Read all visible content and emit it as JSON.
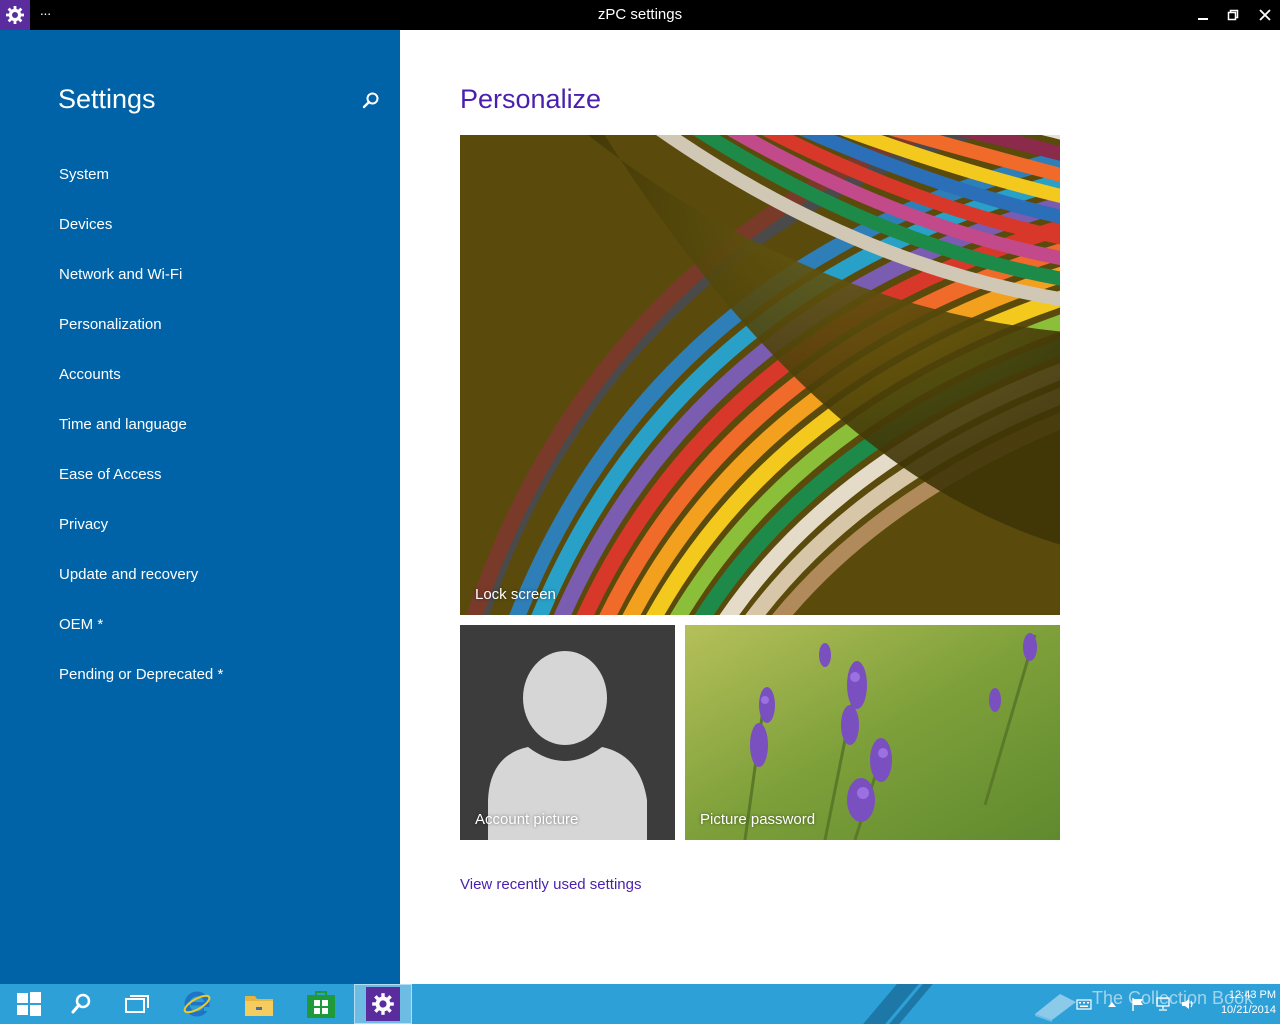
{
  "window": {
    "title": "zPC settings",
    "more_label": "···"
  },
  "sidebar": {
    "title": "Settings",
    "items": [
      {
        "label": "System"
      },
      {
        "label": "Devices"
      },
      {
        "label": "Network and Wi-Fi"
      },
      {
        "label": "Personalization"
      },
      {
        "label": "Accounts"
      },
      {
        "label": "Time and language"
      },
      {
        "label": "Ease of Access"
      },
      {
        "label": "Privacy"
      },
      {
        "label": "Update and recovery"
      },
      {
        "label": "OEM *"
      },
      {
        "label": "Pending or Deprecated *"
      }
    ]
  },
  "main": {
    "title": "Personalize",
    "tiles": {
      "lock_screen": "Lock screen",
      "account_picture": "Account picture",
      "picture_password": "Picture password"
    },
    "recent_link": "View recently used settings"
  },
  "taskbar": {
    "watermark": "The Collection Book",
    "time": "12:43 PM",
    "date": "10/21/2014"
  },
  "colors": {
    "sidebar_bg": "#0063a8",
    "accent": "#4a1fb0",
    "taskbar_bg": "#2da0d8",
    "titlebar_bg": "#000000",
    "app_icon_bg": "#5b2c9e"
  }
}
